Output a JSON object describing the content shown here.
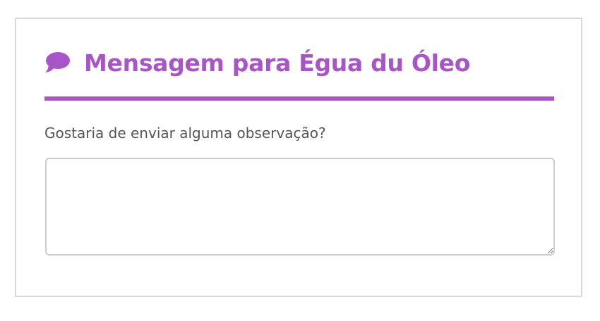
{
  "theme": {
    "accent": "#a855c8",
    "label_color": "#555555",
    "border": "#d9d9d9"
  },
  "header": {
    "icon": "speech-bubble-icon",
    "title": "Mensagem para Égua du Óleo"
  },
  "form": {
    "question": "Gostaria de enviar alguma observação?",
    "message_value": "",
    "message_placeholder": ""
  }
}
